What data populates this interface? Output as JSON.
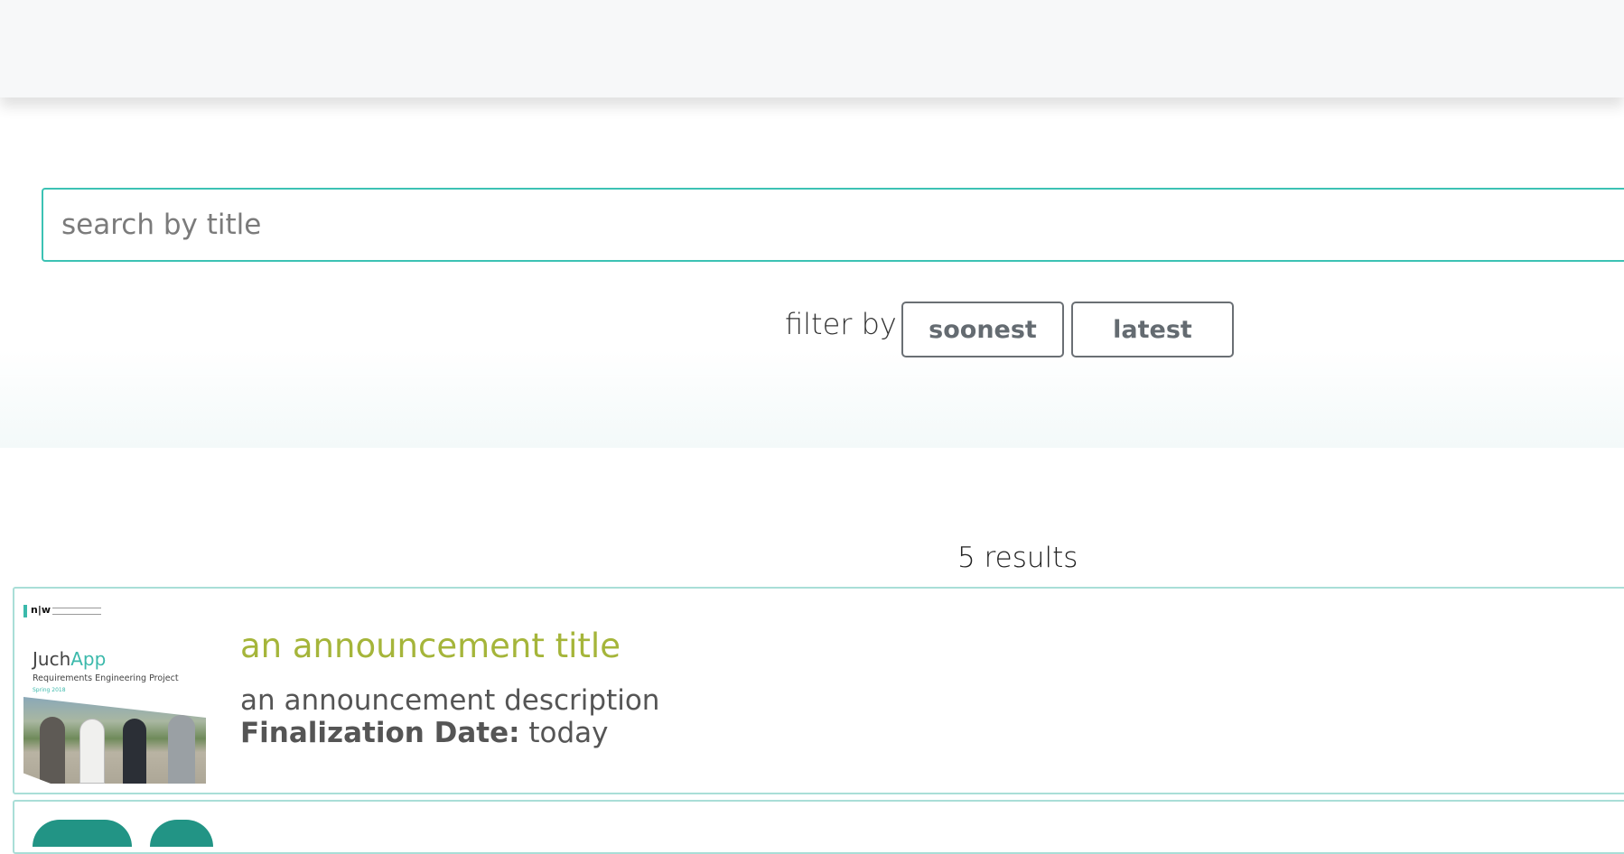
{
  "search": {
    "placeholder": "search by title",
    "value": ""
  },
  "filter": {
    "label": "filter by",
    "options": [
      "soonest",
      "latest"
    ]
  },
  "results": {
    "count_label": "5 results"
  },
  "announcements": [
    {
      "thumbnail": {
        "logo_text": "n|w",
        "app_name_prefix": "Juch",
        "app_name_accent": "App",
        "subtitle": "Requirements Engineering Project",
        "term": "Spring 2018"
      },
      "title": "an announcement title",
      "description": "an announcement description",
      "finalization_label": "Finalization Date:",
      "finalization_value": "today"
    }
  ],
  "colors": {
    "accent_teal": "#3cc2b4",
    "title_olive": "#a5b53a",
    "card_border": "#a9ded7",
    "topbar_bg": "#f7f8f9"
  }
}
